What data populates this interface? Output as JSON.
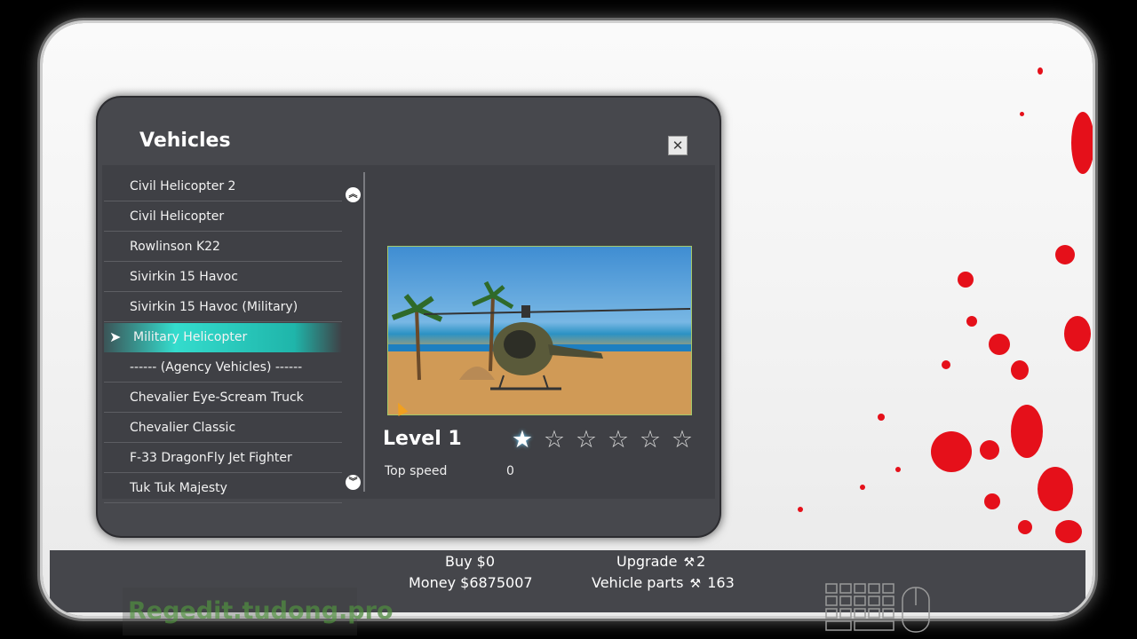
{
  "panel": {
    "title": "Vehicles",
    "close_label": "✕"
  },
  "vehicle_list": {
    "items": [
      "Civil Helicopter 2",
      "Civil Helicopter",
      "Rowlinson K22",
      "Sivirkin 15 Havoc",
      "Sivirkin 15 Havoc (Military)",
      "Military Helicopter",
      "------ (Agency Vehicles) ------",
      "Chevalier Eye-Scream Truck",
      "Chevalier Classic",
      "F-33 DragonFly Jet Fighter",
      "Tuk Tuk Majesty"
    ],
    "selected_index": 5,
    "selected_marker": "➤"
  },
  "scroll": {
    "up_icon": "chevrons-up-icon",
    "down_icon": "chevrons-down-icon",
    "up_glyph": "︽",
    "down_glyph": "︾"
  },
  "details": {
    "level_label": "Level 1",
    "stars_total": 6,
    "stars_filled": 1,
    "star_glyph": "★",
    "star_empty_glyph": "☆",
    "stat_label": "Top speed",
    "stat_value": "0"
  },
  "footer": {
    "buy": "Buy $0",
    "money": "Money $6875007",
    "upgrade_label": "Upgrade",
    "upgrade_value": "2",
    "parts_label": "Vehicle parts",
    "parts_value": "163",
    "wrench_glyph": "🔧"
  },
  "watermark": "Regedit.tudong.pro",
  "colors": {
    "selection": "#34dccd",
    "blood": "#e5101a",
    "panel": "#47484d"
  }
}
